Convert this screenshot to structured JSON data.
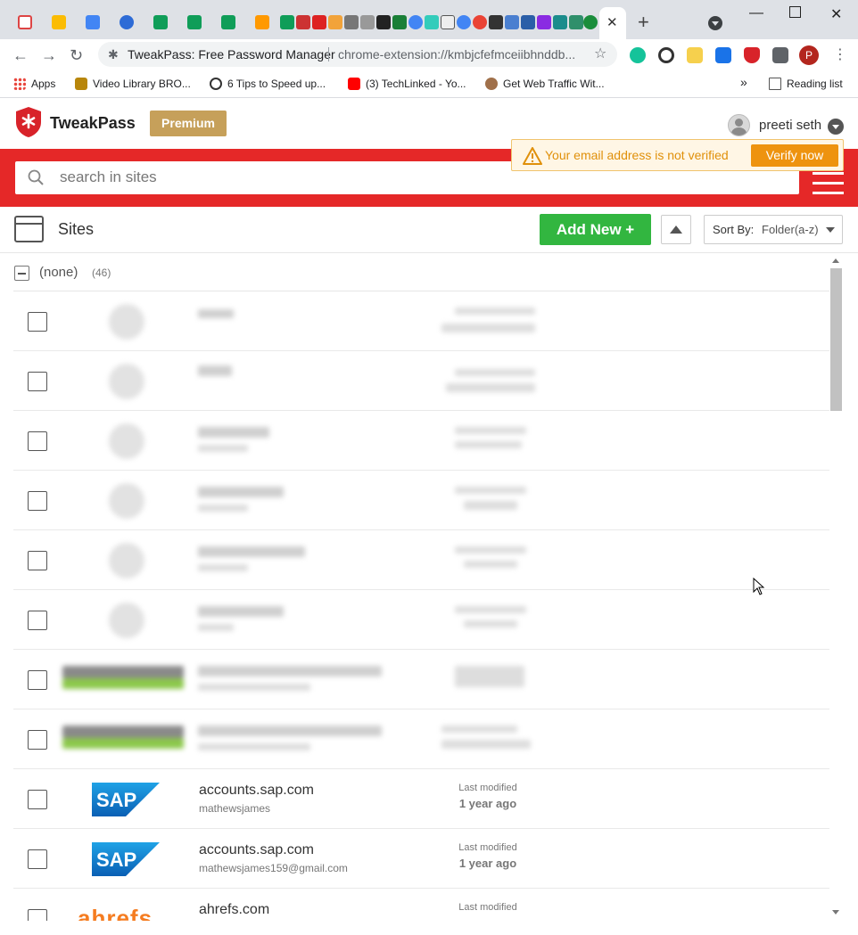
{
  "browser": {
    "omnibox_title": "TweakPass: Free Password Manager",
    "omnibox_url": "chrome-extension://kmbjcfefmceiibhnddb...",
    "bookmarks": [
      {
        "label": "Apps"
      },
      {
        "label": "Video Library BRO..."
      },
      {
        "label": "6 Tips to Speed up..."
      },
      {
        "label": "(3) TechLinked - Yo..."
      },
      {
        "label": "Get Web Traffic Wit..."
      }
    ],
    "more_bookmarks": "»",
    "reading_list": "Reading list",
    "profile_initial": "P"
  },
  "app": {
    "brand": "TweakPass",
    "premium_label": "Premium",
    "user_name": "preeti seth",
    "notice_message": "Your email address is not verified",
    "verify_label": "Verify now",
    "search_placeholder": "search in sites",
    "sites_title": "Sites",
    "add_new_label": "Add New  +",
    "sort_label": "Sort By:",
    "sort_value": "Folder(a-z)",
    "folder_name": "(none)",
    "folder_count": "(46)",
    "entries": [
      {
        "site": "accounts.sap.com",
        "user": "mathewsjames",
        "modified_label": "Last modified",
        "modified": "1 year ago"
      },
      {
        "site": "accounts.sap.com",
        "user": "mathewsjames159@gmail.com",
        "modified_label": "Last modified",
        "modified": "1 year ago"
      },
      {
        "site": "ahrefs.com",
        "user": "",
        "modified_label": "Last modified",
        "modified": ""
      }
    ]
  },
  "colors": {
    "brand_red": "#e52828",
    "premium_gold": "#c6a05a",
    "add_green": "#32b640",
    "verify_orange": "#ee930f"
  }
}
